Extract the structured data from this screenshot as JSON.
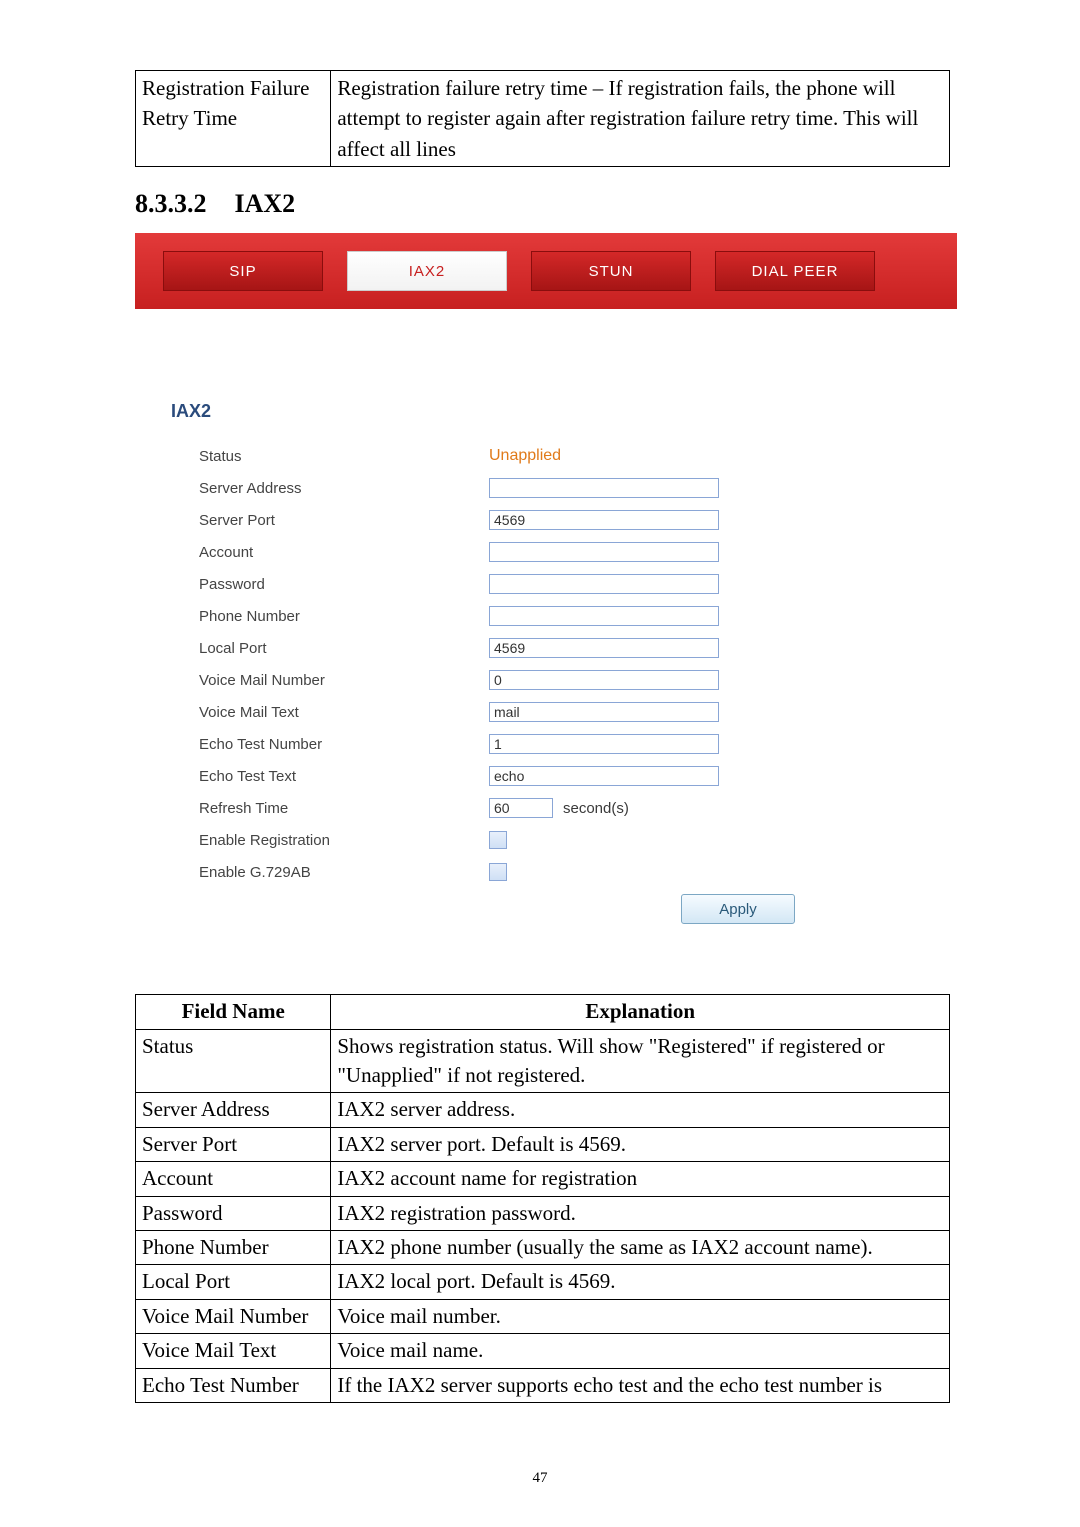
{
  "topTable": {
    "field": "Registration Failure Retry Time",
    "desc": "Registration failure retry time – If registration fails, the phone will attempt to register again after registration failure retry time. This will affect all lines"
  },
  "heading": {
    "number": "8.3.3.2",
    "title": "IAX2"
  },
  "tabs": {
    "sip": "SIP",
    "iax2": "IAX2",
    "stun": "STUN",
    "dial": "DIAL PEER"
  },
  "formTitle": "IAX2",
  "form": {
    "status": {
      "label": "Status",
      "value": "Unapplied"
    },
    "server_addr": {
      "label": "Server Address",
      "value": ""
    },
    "server_port": {
      "label": "Server Port",
      "value": "4569"
    },
    "account": {
      "label": "Account",
      "value": ""
    },
    "password": {
      "label": "Password",
      "value": ""
    },
    "phone": {
      "label": "Phone Number",
      "value": ""
    },
    "local_port": {
      "label": "Local Port",
      "value": "4569"
    },
    "vm_number": {
      "label": "Voice Mail Number",
      "value": "0"
    },
    "vm_text": {
      "label": "Voice Mail Text",
      "value": "mail"
    },
    "echo_num": {
      "label": "Echo Test Number",
      "value": "1"
    },
    "echo_text": {
      "label": "Echo Test Text",
      "value": "echo"
    },
    "refresh": {
      "label": "Refresh Time",
      "value": "60",
      "unit": "second(s)"
    },
    "enable_reg": {
      "label": "Enable Registration"
    },
    "enable_g729": {
      "label": "Enable G.729AB"
    }
  },
  "applyLabel": "Apply",
  "explain": {
    "header": {
      "field": "Field Name",
      "exp": "Explanation"
    },
    "rows": [
      {
        "field": "Status",
        "exp": "Shows registration status.   Will show \"Registered\" if registered or \"Unapplied\" if not registered."
      },
      {
        "field": "Server Address",
        "exp": "IAX2 server address."
      },
      {
        "field": "Server Port",
        "exp": "IAX2 server port. Default is 4569."
      },
      {
        "field": "Account",
        "exp": "IAX2 account name for registration"
      },
      {
        "field": "Password",
        "exp": "IAX2 registration password."
      },
      {
        "field": "Phone Number",
        "exp": "IAX2 phone number (usually the same as IAX2 account name)."
      },
      {
        "field": "Local Port",
        "exp": "IAX2 local port. Default is 4569."
      },
      {
        "field": "Voice Mail Number",
        "exp": "Voice mail number."
      },
      {
        "field": "Voice Mail Text",
        "exp": "Voice mail name."
      },
      {
        "field": "Echo Test Number",
        "exp": "If the IAX2 server supports echo test and the echo test number is"
      }
    ]
  },
  "pageNumber": "47"
}
